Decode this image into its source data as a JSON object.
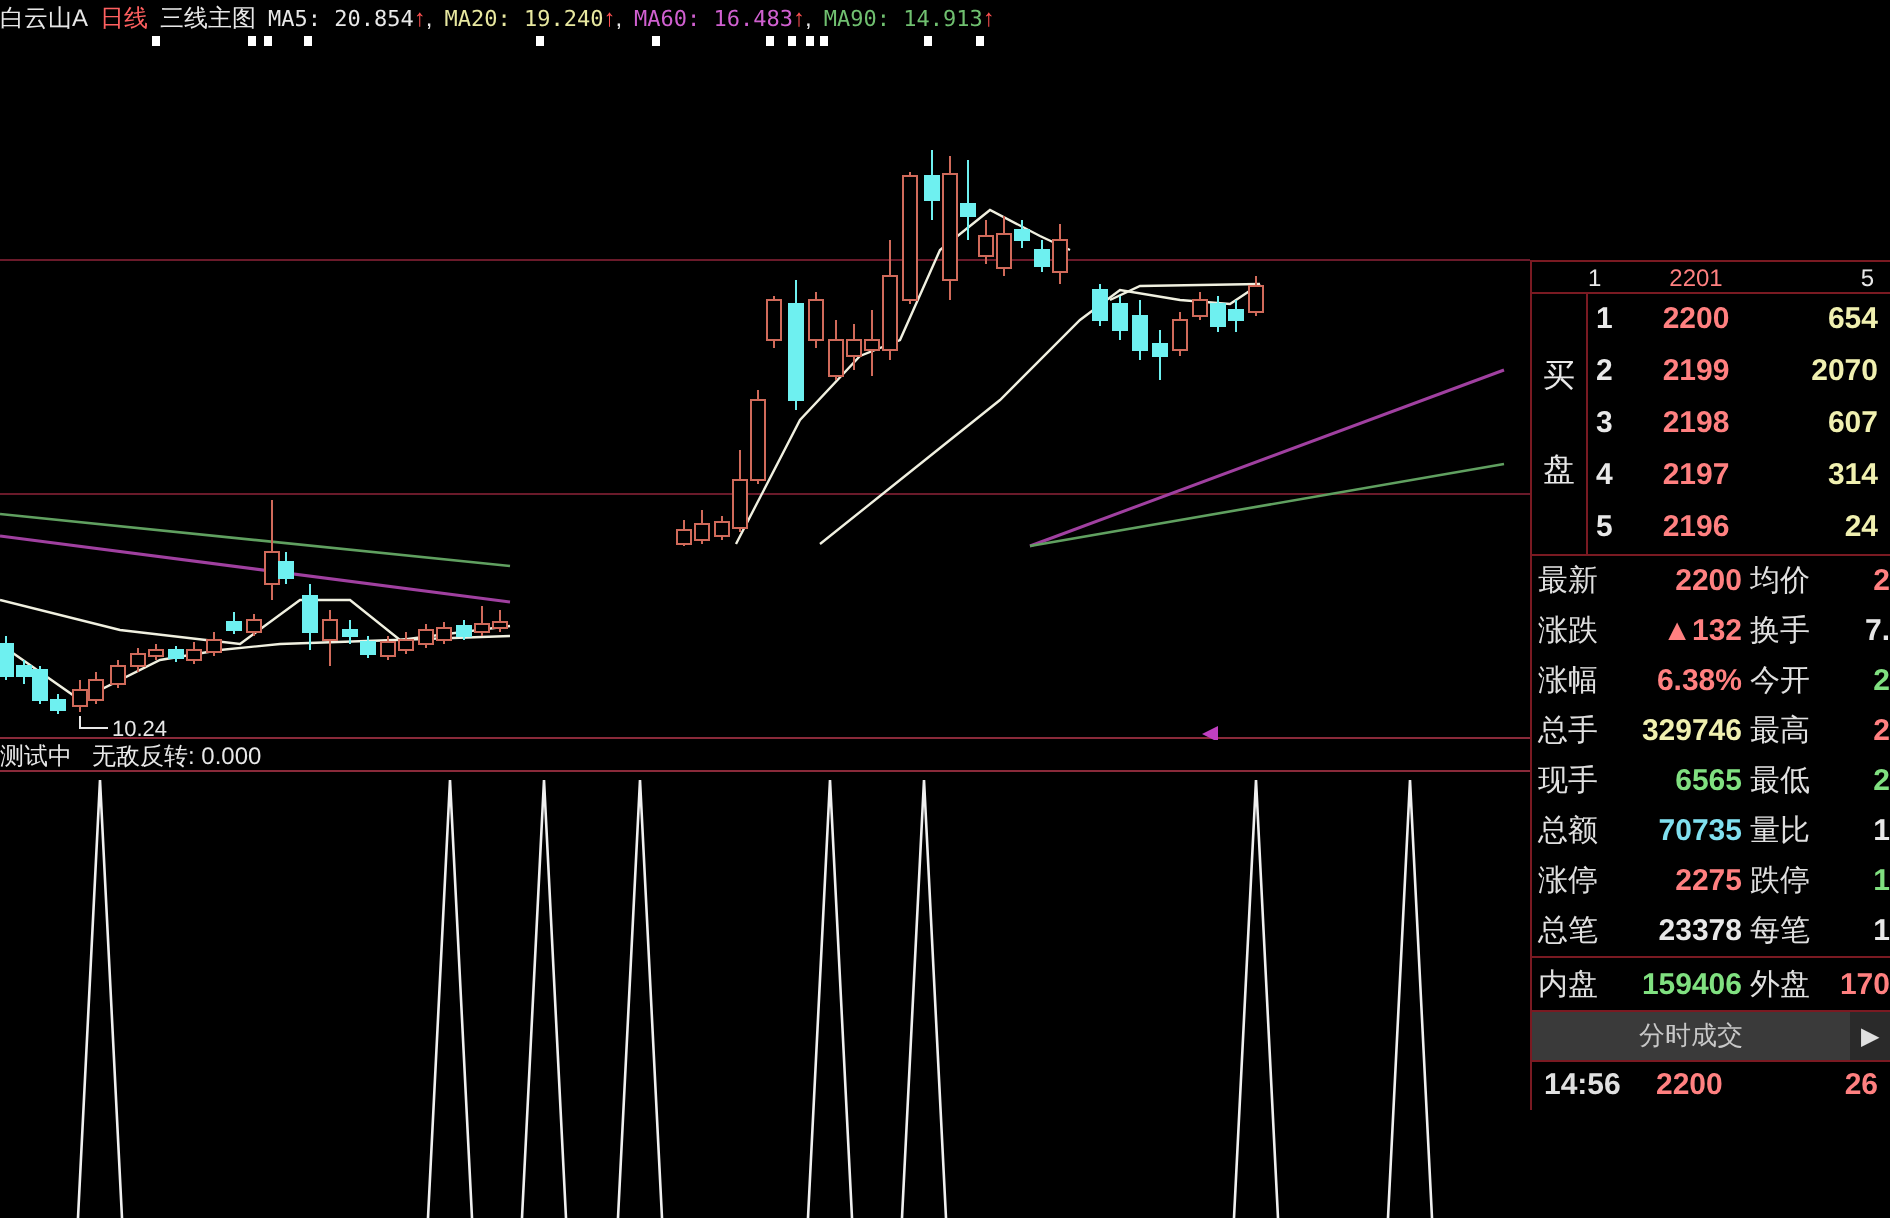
{
  "header": {
    "stock": "白云山A",
    "period": "日线",
    "template": "三线主图",
    "indicators": [
      {
        "label": "MA5: 20.854",
        "arrow": "↑",
        "sep": ",",
        "color": "#e8e8e8"
      },
      {
        "label": "MA20: 19.240",
        "arrow": "↑",
        "sep": ",",
        "color": "#e8e8a0"
      },
      {
        "label": "MA60: 16.483",
        "arrow": "↑",
        "sep": ",",
        "color": "#d060d0"
      },
      {
        "label": "MA90: 14.913",
        "arrow": "↑",
        "color": "#70c070"
      }
    ]
  },
  "chart": {
    "low_label": "10.24"
  },
  "indicator_panel": {
    "name": "测试中",
    "formula": "无敌反转: 0.000"
  },
  "quote": {
    "sell_row": {
      "level": "1",
      "price": "2201",
      "volume": "5"
    },
    "buy_label": [
      "买",
      "盘"
    ],
    "buy_rows": [
      {
        "level": "1",
        "price": "2200",
        "volume": "654"
      },
      {
        "level": "2",
        "price": "2199",
        "volume": "2070"
      },
      {
        "level": "3",
        "price": "2198",
        "volume": "607"
      },
      {
        "level": "4",
        "price": "2197",
        "volume": "314"
      },
      {
        "level": "5",
        "price": "2196",
        "volume": "24"
      }
    ],
    "stats": [
      [
        {
          "label": "最新",
          "value": "2200",
          "color": "#ff8080"
        },
        {
          "label": "均价",
          "value": "2",
          "color": "#ff8080"
        }
      ],
      [
        {
          "label": "涨跌",
          "value": "▲132",
          "color": "#ff8080"
        },
        {
          "label": "换手",
          "value": "7.",
          "color": "#e8e8e8"
        }
      ],
      [
        {
          "label": "涨幅",
          "value": "6.38%",
          "color": "#ff8080"
        },
        {
          "label": "今开",
          "value": "2",
          "color": "#80e080"
        }
      ],
      [
        {
          "label": "总手",
          "value": "329746",
          "color": "#f0f0b0"
        },
        {
          "label": "最高",
          "value": "2",
          "color": "#ff8080"
        }
      ],
      [
        {
          "label": "现手",
          "value": "6565",
          "color": "#80e080"
        },
        {
          "label": "最低",
          "value": "2",
          "color": "#80e080"
        }
      ],
      [
        {
          "label": "总额",
          "value": "70735",
          "color": "#80e0f0"
        },
        {
          "label": "量比",
          "value": "1",
          "color": "#e8e8e8"
        }
      ],
      [
        {
          "label": "涨停",
          "value": "2275",
          "color": "#ff8080"
        },
        {
          "label": "跌停",
          "value": "1",
          "color": "#80e080"
        }
      ],
      [
        {
          "label": "总笔",
          "value": "23378",
          "color": "#e8e8e8"
        },
        {
          "label": "每笔",
          "value": "1",
          "color": "#e8e8e8"
        }
      ],
      [
        {
          "label": "内盘",
          "value": "159406",
          "color": "#80e080"
        },
        {
          "label": "外盘",
          "value": "170",
          "color": "#ff8080"
        }
      ]
    ],
    "ticks_tab": {
      "label": "分时成交",
      "arrow": "▶"
    },
    "ticks": [
      {
        "time": "14:56",
        "price": "2200",
        "volume": "26"
      }
    ]
  }
}
